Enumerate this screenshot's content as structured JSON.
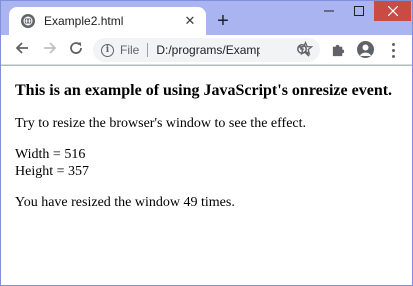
{
  "browser": {
    "tab_title": "Example2.html",
    "new_tab_symbol": "+",
    "close_symbol": "✕",
    "scheme_label": "File",
    "url": "D:/programs/Exampl..."
  },
  "page": {
    "heading": "This is an example of using JavaScript's onresize event.",
    "instruction": "Try to resize the browser's window to see the effect.",
    "width_text": "Width = 516",
    "height_text": "Height = 357",
    "count_text": "You have resized the window 49 times."
  },
  "colors": {
    "frame": "#a9b4f0",
    "close_button": "#c94b44"
  }
}
